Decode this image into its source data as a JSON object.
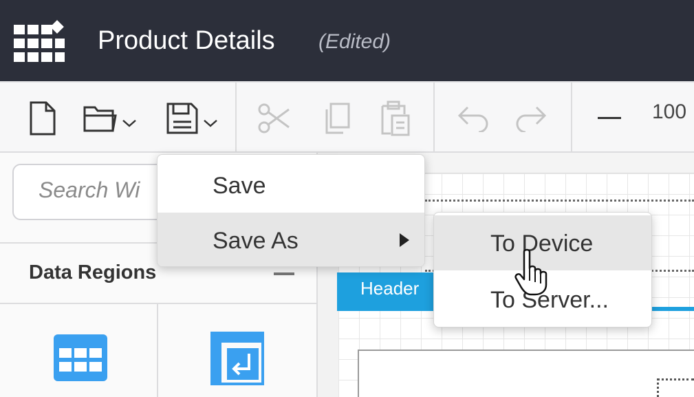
{
  "header": {
    "title": "Product Details",
    "status": "(Edited)",
    "bg_color": "#2c2f3a"
  },
  "toolbar": {
    "buttons": [
      {
        "name": "new-report",
        "icon": "new-file-icon",
        "enabled": true
      },
      {
        "name": "open",
        "icon": "open-folder-icon",
        "dropdown": true,
        "enabled": true
      },
      {
        "name": "save",
        "icon": "save-icon",
        "dropdown": true,
        "enabled": true
      },
      {
        "name": "cut",
        "icon": "scissors-icon",
        "enabled": false
      },
      {
        "name": "copy",
        "icon": "copy-icon",
        "enabled": false
      },
      {
        "name": "paste",
        "icon": "paste-icon",
        "enabled": false
      },
      {
        "name": "undo",
        "icon": "undo-icon",
        "enabled": false
      },
      {
        "name": "redo",
        "icon": "redo-icon",
        "enabled": false
      },
      {
        "name": "zoom-out",
        "icon": "minus-icon",
        "enabled": true
      }
    ],
    "zoom_value": "100"
  },
  "left_panel": {
    "search_placeholder": "Search Wi",
    "section_title": "Data Regions",
    "tiles": [
      {
        "icon": "table-icon"
      },
      {
        "icon": "matrix-icon"
      }
    ]
  },
  "canvas": {
    "band_label": "Header",
    "accent_color": "#1ea0de"
  },
  "save_menu": {
    "items": [
      {
        "label": "Save",
        "has_submenu": false
      },
      {
        "label": "Save As",
        "has_submenu": true,
        "highlighted": true
      }
    ]
  },
  "save_as_submenu": {
    "items": [
      {
        "label": "To Device",
        "hovered": true
      },
      {
        "label": "To Server...",
        "hovered": false
      }
    ]
  }
}
